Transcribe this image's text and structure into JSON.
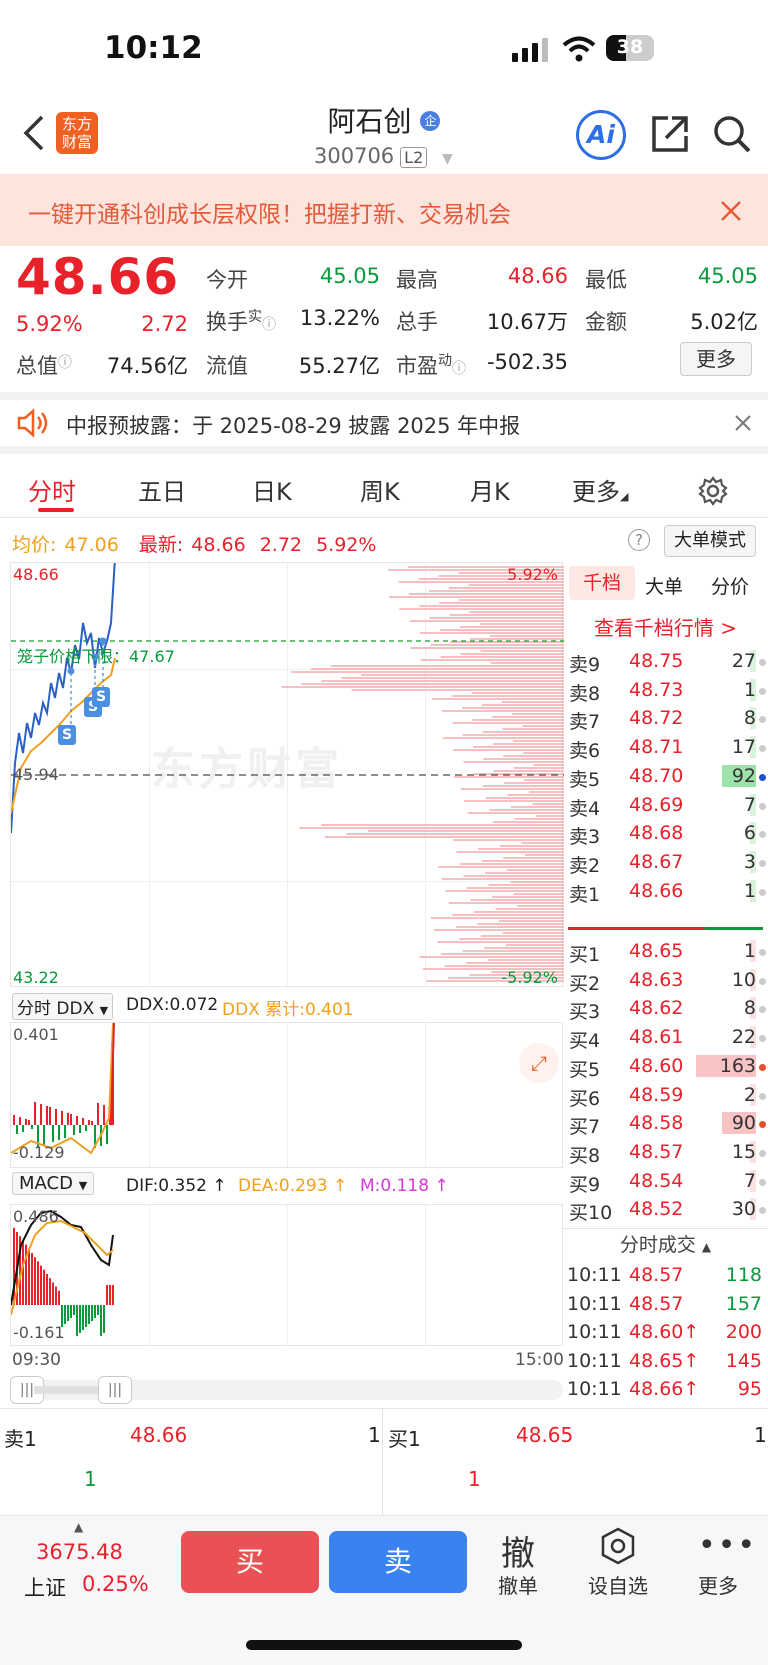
{
  "status": {
    "time": "10:12",
    "battery": "38"
  },
  "header": {
    "title": "阿石创",
    "code": "300706",
    "l2": "L2",
    "badge": "企"
  },
  "banner": {
    "text": "一键开通科创成长层权限！把握打新、交易机会"
  },
  "quote": {
    "price": "48.66",
    "pct": "5.92%",
    "chg": "2.72",
    "rows": [
      [
        {
          "l": "今开",
          "v": "45.05",
          "c": "green"
        },
        {
          "l": "最高",
          "v": "48.66",
          "c": "red"
        },
        {
          "l": "最低",
          "v": "45.05",
          "c": "green"
        }
      ],
      [
        {
          "l": "换手",
          "v": "13.22%",
          "c": ""
        },
        {
          "l": "总手",
          "v": "10.67万",
          "c": ""
        },
        {
          "l": "金额",
          "v": "5.02亿",
          "c": ""
        }
      ]
    ],
    "row3": {
      "zong_lbl": "总值",
      "zong_val": "74.56亿",
      "liu_lbl": "流值",
      "liu_val": "55.27亿",
      "pe_lbl": "市盈",
      "pe_val": "-502.35",
      "shi": "实",
      "dong": "动"
    },
    "more": "更多"
  },
  "notice": {
    "text": "中报预披露：于 2025-08-29 披露 2025 年中报"
  },
  "tabs": [
    "分时",
    "五日",
    "日K",
    "周K",
    "月K",
    "更多"
  ],
  "subbar": {
    "avg_lbl": "均价:",
    "avg_val": "47.06",
    "new_lbl": "最新:",
    "new_val": "48.66",
    "chg": "2.72",
    "pct": "5.92%",
    "mode": "大单模式"
  },
  "chart": {
    "high": "48.66",
    "mid": "45.94",
    "low": "43.22",
    "pct_hi": "5.92%",
    "pct_lo": "-5.92%",
    "cage": "笼子价格下限：47.67",
    "watermark": "东方财富"
  },
  "ddx": {
    "sel": "分时 DDX",
    "ddx": "DDX:0.072",
    "sum": "DDX 累计:0.401",
    "hi": "0.401",
    "lo": "-0.129"
  },
  "macd": {
    "sel": "MACD",
    "dif": "DIF:0.352 ↑",
    "dea": "DEA:0.293 ↑",
    "m": "M:0.118 ↑",
    "hi": "0.486",
    "lo": "-0.161",
    "t0": "09:30",
    "t1": "15:00"
  },
  "ob_tabs": [
    "千档",
    "大单",
    "分价"
  ],
  "ob_link": "查看千档行情 >",
  "asks": [
    [
      "卖9",
      "48.75",
      "27"
    ],
    [
      "卖8",
      "48.73",
      "1"
    ],
    [
      "卖7",
      "48.72",
      "8"
    ],
    [
      "卖6",
      "48.71",
      "17"
    ],
    [
      "卖5",
      "48.70",
      "92"
    ],
    [
      "卖4",
      "48.69",
      "7"
    ],
    [
      "卖3",
      "48.68",
      "6"
    ],
    [
      "卖2",
      "48.67",
      "3"
    ],
    [
      "卖1",
      "48.66",
      "1"
    ]
  ],
  "bids": [
    [
      "买1",
      "48.65",
      "1"
    ],
    [
      "买2",
      "48.63",
      "10"
    ],
    [
      "买3",
      "48.62",
      "8"
    ],
    [
      "买4",
      "48.61",
      "22"
    ],
    [
      "买5",
      "48.60",
      "163"
    ],
    [
      "买6",
      "48.59",
      "2"
    ],
    [
      "买7",
      "48.58",
      "90"
    ],
    [
      "买8",
      "48.57",
      "15"
    ],
    [
      "买9",
      "48.54",
      "7"
    ],
    [
      "买10",
      "48.52",
      "30"
    ]
  ],
  "ticks_title": "分时成交",
  "ticks": [
    [
      "10:11",
      "48.57",
      "118",
      "green"
    ],
    [
      "10:11",
      "48.57",
      "157",
      "green"
    ],
    [
      "10:11",
      "48.60↑",
      "200",
      "red"
    ],
    [
      "10:11",
      "48.65↑",
      "145",
      "red"
    ],
    [
      "10:11",
      "48.66↑",
      "95",
      "red"
    ]
  ],
  "bottom_quote": {
    "sell_lbl": "卖1",
    "sell_price": "48.66",
    "sell_vol": "1",
    "sell_sub": "1",
    "buy_lbl": "买1",
    "buy_price": "48.65",
    "buy_vol": "1",
    "buy_sub": "1"
  },
  "index": {
    "value": "3675.48",
    "name": "上证",
    "pct": "0.25%"
  },
  "actions": {
    "buy": "买",
    "sell": "卖",
    "cancel_icon": "撤",
    "cancel": "撤单",
    "watch": "设自选",
    "more": "更多"
  }
}
